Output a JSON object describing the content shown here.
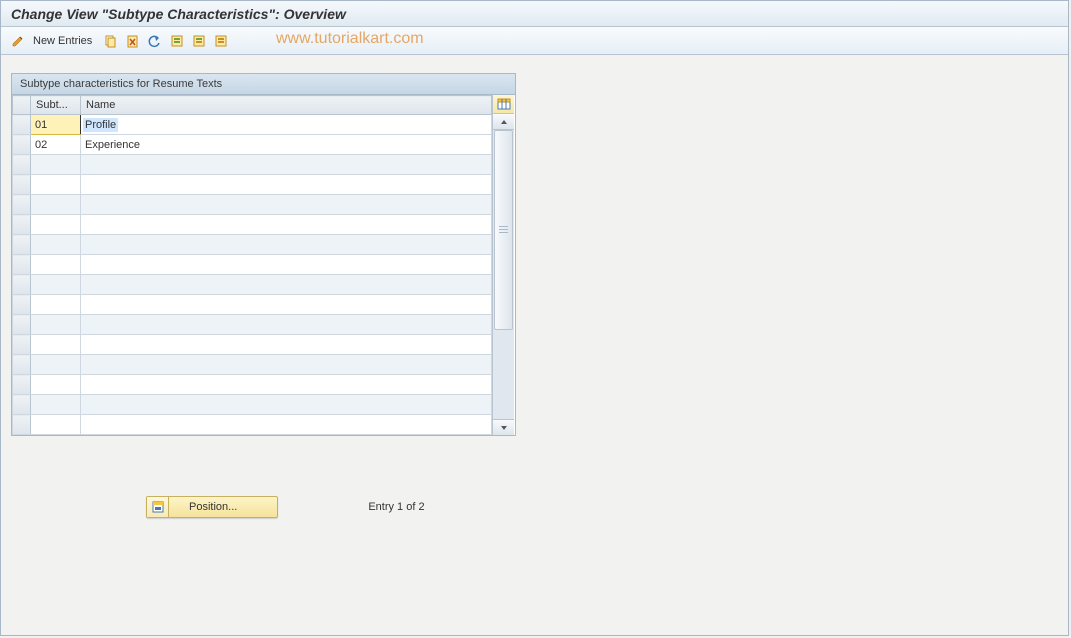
{
  "header": {
    "title": "Change View \"Subtype Characteristics\": Overview"
  },
  "toolbar": {
    "new_entries_label": "New Entries"
  },
  "watermark": "www.tutorialkart.com",
  "panel": {
    "title": "Subtype characteristics for Resume Texts",
    "columns": {
      "subt": "Subt...",
      "name": "Name"
    },
    "rows": [
      {
        "subt": "01",
        "name": "Profile",
        "selected": true
      },
      {
        "subt": "02",
        "name": "Experience",
        "selected": false
      }
    ],
    "blank_rows": 14
  },
  "footer": {
    "position_label": "Position...",
    "status": "Entry 1 of 2"
  }
}
